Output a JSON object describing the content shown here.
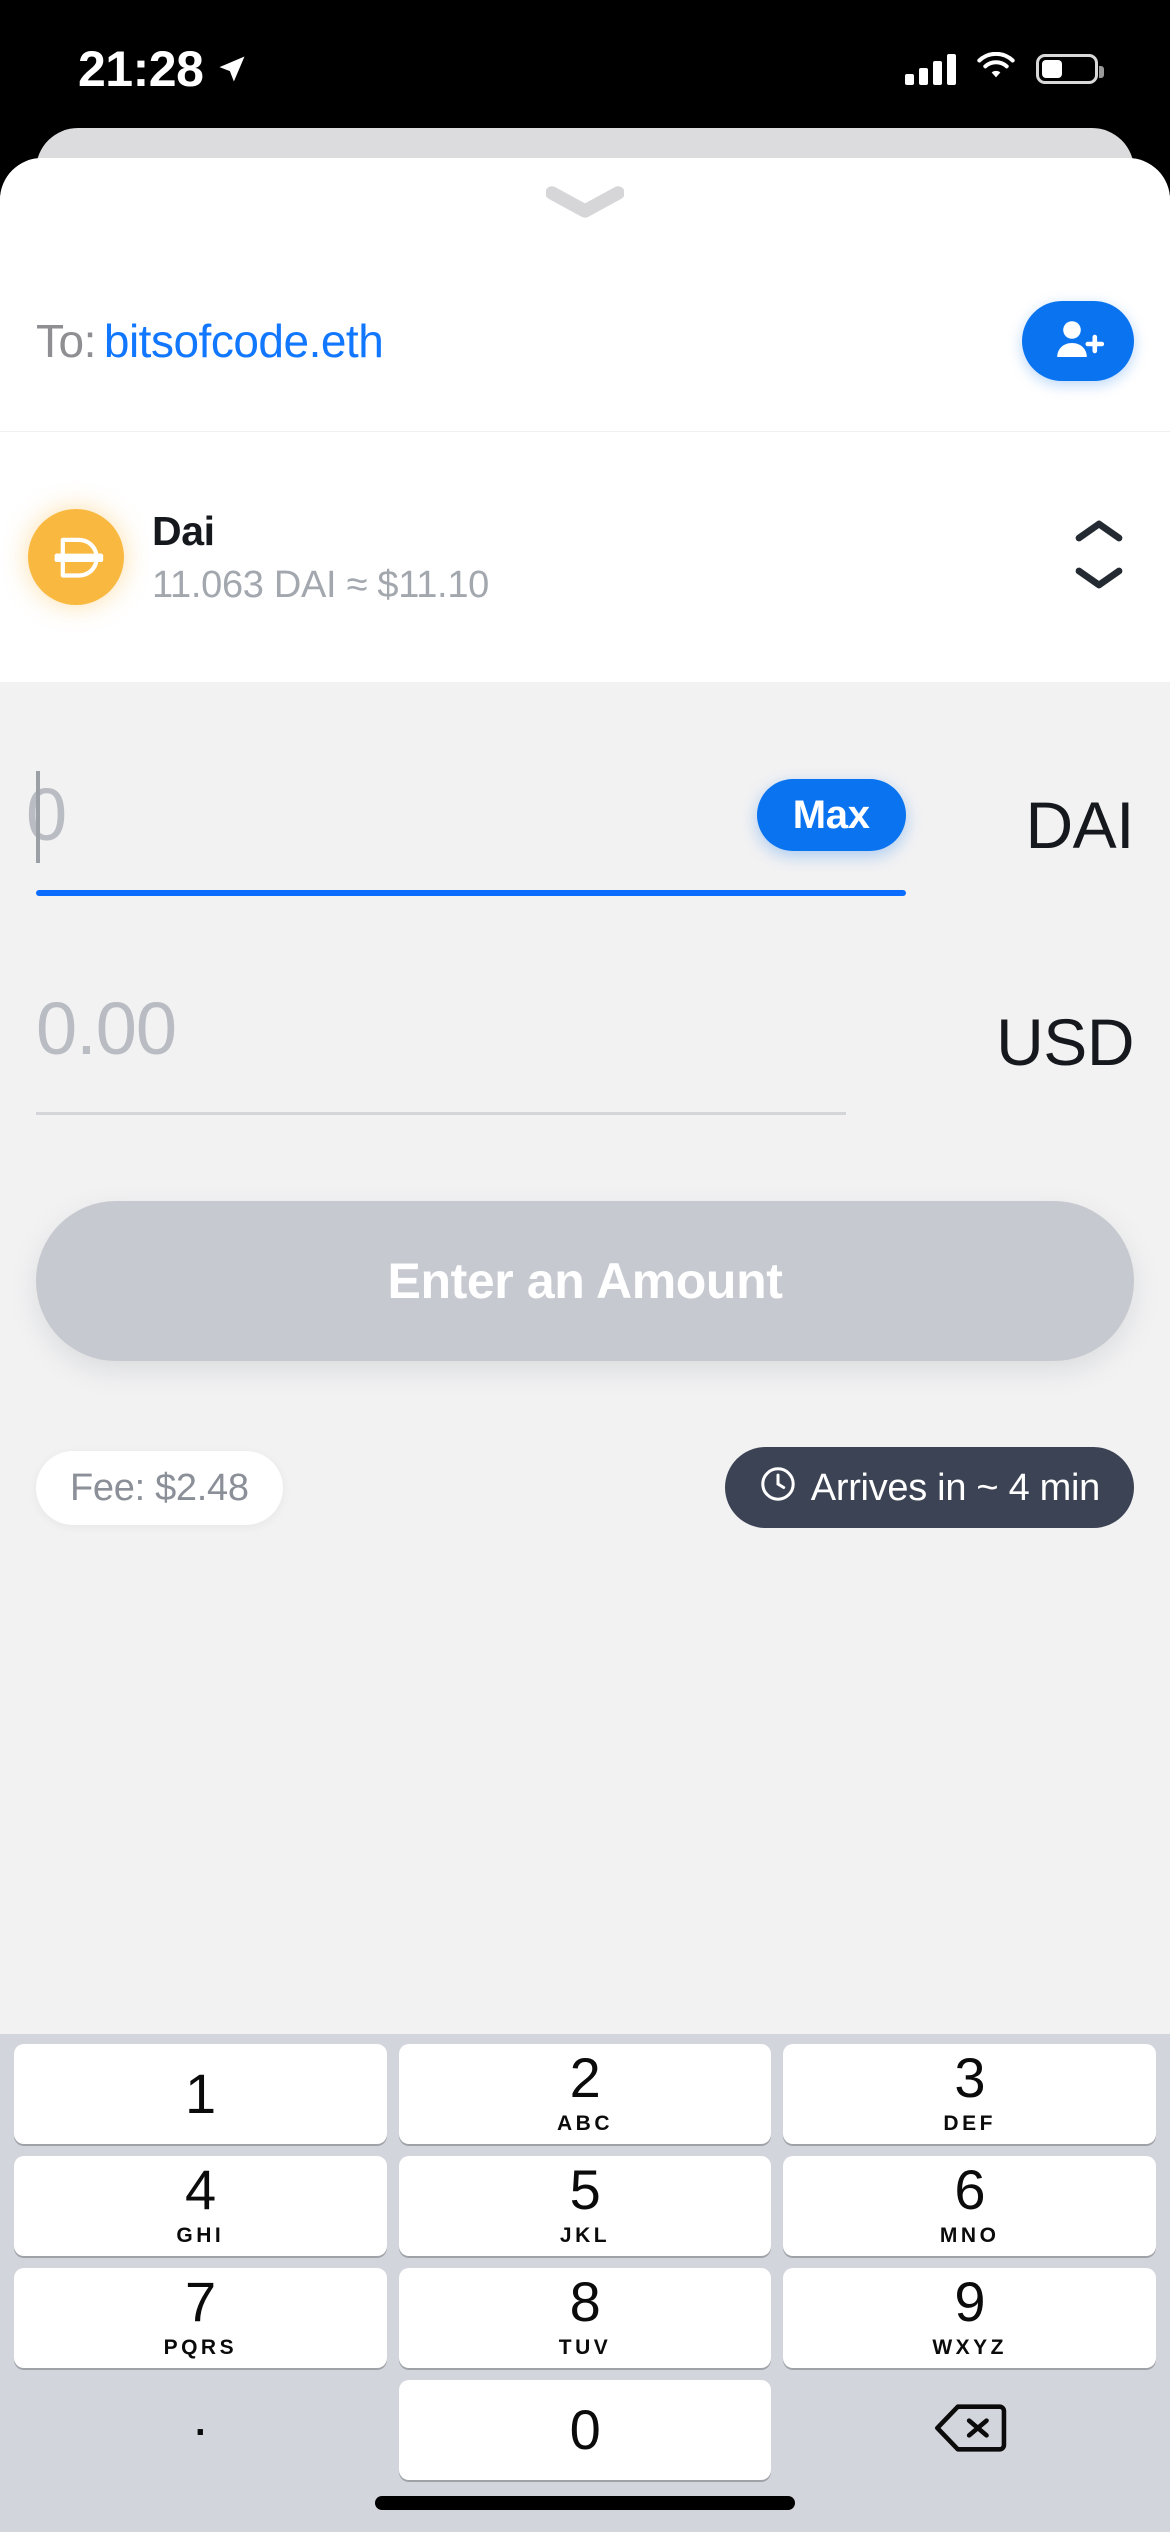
{
  "status_bar": {
    "time": "21:28",
    "location_icon": "location-arrow-icon",
    "cellular_icon": "cellular-signal-icon",
    "wifi_icon": "wifi-icon",
    "battery_icon": "battery-icon"
  },
  "sheet": {
    "grabber_icon": "chevron-down-handle-icon"
  },
  "recipient": {
    "label": "To:",
    "value": "bitsofcode.eth",
    "add_contact_icon": "add-contact-icon"
  },
  "token": {
    "name": "Dai",
    "balance": "11.063 DAI ≈ $11.10",
    "logo_icon": "dai-coin-icon",
    "stepper_up_icon": "chevron-up-icon",
    "stepper_down_icon": "chevron-down-icon"
  },
  "amount": {
    "crypto": {
      "value": "",
      "placeholder": "0",
      "currency": "DAI",
      "max_label": "Max",
      "active": true
    },
    "fiat": {
      "value": "",
      "placeholder": "0.00",
      "currency": "USD",
      "active": false
    }
  },
  "cta": {
    "label": "Enter an Amount",
    "enabled": false
  },
  "transaction_meta": {
    "fee_label": "Fee: $2.48",
    "eta_label": "Arrives in ~ 4 min",
    "clock_icon": "clock-icon"
  },
  "keypad": {
    "keys": [
      {
        "num": "1",
        "sub": ""
      },
      {
        "num": "2",
        "sub": "ABC"
      },
      {
        "num": "3",
        "sub": "DEF"
      },
      {
        "num": "4",
        "sub": "GHI"
      },
      {
        "num": "5",
        "sub": "JKL"
      },
      {
        "num": "6",
        "sub": "MNO"
      },
      {
        "num": "7",
        "sub": "PQRS"
      },
      {
        "num": "8",
        "sub": "TUV"
      },
      {
        "num": "9",
        "sub": "WXYZ"
      },
      {
        "num": ".",
        "sub": ""
      },
      {
        "num": "0",
        "sub": ""
      }
    ],
    "decimal_label": ".",
    "zero_label": "0",
    "delete_icon": "backspace-delete-icon"
  },
  "colors": {
    "accent_blue": "#0A74F0",
    "dai_gold": "#F9B941",
    "eta_dark": "#3C4354",
    "disabled_grey": "#C6C9CF",
    "keyboard_bg": "#D2D5DB"
  }
}
